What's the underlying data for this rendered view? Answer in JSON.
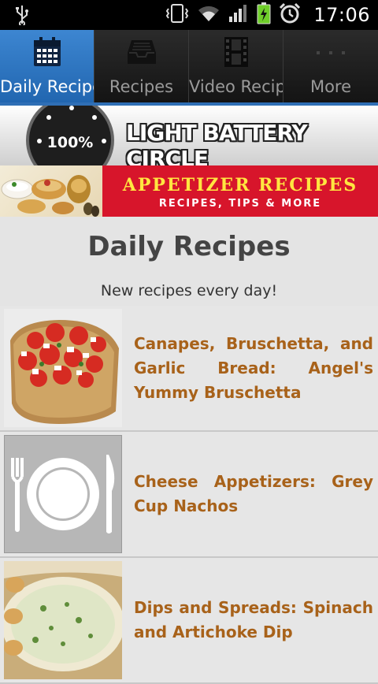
{
  "status_bar": {
    "time": "17:06",
    "icons": [
      "usb-icon",
      "vibrate-icon",
      "wifi-icon",
      "signal-icon",
      "battery-charging-icon",
      "alarm-icon"
    ],
    "battery_color": "#6fcf2a"
  },
  "tabs": [
    {
      "label": "Daily Recipes",
      "icon": "calendar-icon",
      "active": true
    },
    {
      "label": "Recipes",
      "icon": "inbox-tray-icon",
      "active": false
    },
    {
      "label": "Video Recipe",
      "icon": "film-icon",
      "active": false
    },
    {
      "label": "More",
      "icon": "more-dots-icon",
      "active": false
    }
  ],
  "ads": {
    "battery_banner": {
      "percent": "100%",
      "title": "LIGHT BATTERY CIRCLE"
    },
    "appetizer_banner": {
      "title": "APPETIZER RECIPES",
      "subtitle": "RECIPES, TIPS & MORE"
    }
  },
  "header": {
    "title": "Daily Recipes",
    "subtitle": "New recipes every day!"
  },
  "recipes": [
    {
      "title": "Canapes, Bruschetta, and Garlic Bread: Angel's Yummy Bruschetta",
      "thumb": "bruschetta-photo"
    },
    {
      "title": "Cheese Appetizers: Grey Cup Nachos",
      "thumb": "placeholder-plate-icon"
    },
    {
      "title": "Dips and Spreads: Spinach and Artichoke Dip",
      "thumb": "dip-photo"
    }
  ],
  "colors": {
    "active_tab": "#2f7bc6",
    "recipe_title": "#a8621a",
    "list_background": "#e6e6e6",
    "ad_red": "#d7152b",
    "ad_yellow": "#ffe640"
  }
}
